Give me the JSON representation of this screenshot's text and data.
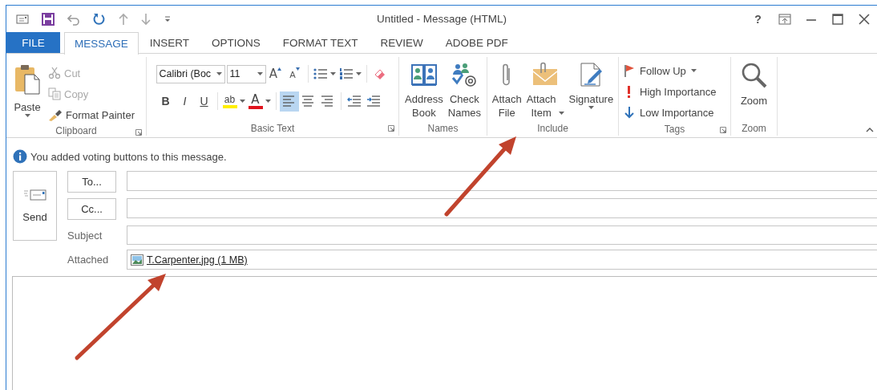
{
  "title_bar": {
    "title": "Untitled - Message (HTML)",
    "help": "?"
  },
  "tabs": [
    {
      "label": "FILE",
      "kind": "file",
      "selected": false
    },
    {
      "label": "MESSAGE",
      "kind": "tab",
      "selected": true
    },
    {
      "label": "INSERT",
      "kind": "tab",
      "selected": false
    },
    {
      "label": "OPTIONS",
      "kind": "tab",
      "selected": false
    },
    {
      "label": "FORMAT TEXT",
      "kind": "tab",
      "selected": false
    },
    {
      "label": "REVIEW",
      "kind": "tab",
      "selected": false
    },
    {
      "label": "ADOBE PDF",
      "kind": "tab",
      "selected": false
    }
  ],
  "ribbon": {
    "groups": [
      {
        "kind": "clipboard",
        "label": "Clipboard",
        "launcher": true,
        "paste": {
          "label": "Paste",
          "dropdown": true
        },
        "commands": [
          {
            "label": "Cut",
            "disabled": true
          },
          {
            "label": "Copy",
            "disabled": true
          },
          {
            "label": "Format Painter",
            "disabled": false
          }
        ]
      },
      {
        "kind": "basic_text",
        "label": "Basic Text",
        "launcher": true,
        "font_name": "Calibri (Boc",
        "font_size": "11",
        "row_1": [
          {
            "kind": "grow_font",
            "text": "A"
          },
          {
            "kind": "shrink_font",
            "text": "A"
          },
          {
            "kind": "separator"
          },
          {
            "kind": "bullets",
            "dropdown": true
          },
          {
            "kind": "numbering",
            "dropdown": true
          },
          {
            "kind": "separator"
          },
          {
            "kind": "clear_formatting"
          }
        ],
        "row_2": [
          {
            "kind": "bold",
            "text": "B",
            "selected": false
          },
          {
            "kind": "italic",
            "text": "I",
            "selected": false
          },
          {
            "kind": "underline",
            "text": "U",
            "selected": false
          },
          {
            "kind": "separator"
          },
          {
            "kind": "highlight",
            "text": "ab",
            "dropdown": true
          },
          {
            "kind": "font_color",
            "text": "A",
            "dropdown": true
          },
          {
            "kind": "separator"
          },
          {
            "kind": "align_left",
            "selected": true
          },
          {
            "kind": "align_center",
            "selected": false
          },
          {
            "kind": "align_right",
            "selected": false
          },
          {
            "kind": "separator"
          },
          {
            "kind": "decrease_indent"
          },
          {
            "kind": "increase_indent"
          }
        ]
      },
      {
        "kind": "names",
        "label": "Names",
        "buttons": [
          {
            "label": "Address Book",
            "kind": "button"
          },
          {
            "label": "Check Names",
            "kind": "button"
          }
        ]
      },
      {
        "kind": "include",
        "label": "Include",
        "buttons": [
          {
            "label": "Attach File",
            "kind": "button"
          },
          {
            "label": "Attach Item",
            "kind": "menu"
          },
          {
            "label": "Signature",
            "kind": "split"
          }
        ]
      },
      {
        "kind": "tags",
        "label": "Tags",
        "launcher": true,
        "commands": [
          {
            "label": "Follow Up",
            "dropdown": true
          },
          {
            "label": "High Importance",
            "dropdown": false
          },
          {
            "label": "Low Importance",
            "dropdown": false
          }
        ]
      },
      {
        "kind": "zoom",
        "label": "Zoom",
        "buttons": [
          {
            "label": "Zoom",
            "kind": "button"
          }
        ]
      }
    ]
  },
  "info_bar": {
    "message": "You added voting buttons to this message."
  },
  "compose": {
    "send": "Send",
    "rows": [
      {
        "kind": "button",
        "label": "To..."
      },
      {
        "kind": "button",
        "label": "Cc..."
      },
      {
        "kind": "label",
        "label": "Subject"
      },
      {
        "kind": "attachments",
        "label": "Attached",
        "files": [
          "T.Carpenter.jpg (1 MB)"
        ]
      }
    ]
  }
}
